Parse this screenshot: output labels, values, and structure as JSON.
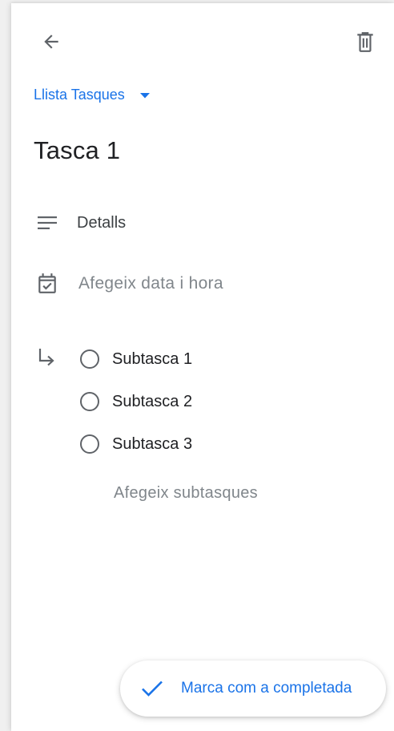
{
  "header": {
    "back_icon": "arrow-left-icon",
    "delete_icon": "trash-icon"
  },
  "list_selector": {
    "label": "Llista Tasques",
    "icon": "caret-down-icon"
  },
  "task": {
    "title": "Tasca 1",
    "details_label": "Detalls",
    "details_icon": "notes-icon",
    "date_placeholder": "Afegeix data i hora",
    "date_icon": "calendar-check-icon"
  },
  "subtasks": {
    "icon": "subdirectory-arrow-icon",
    "items": [
      {
        "label": "Subtasca 1"
      },
      {
        "label": "Subtasca 2"
      },
      {
        "label": "Subtasca 3"
      }
    ],
    "add_label": "Afegeix subtasques"
  },
  "footer": {
    "complete_label": "Marca com a completada",
    "complete_icon": "check-icon"
  },
  "colors": {
    "accent": "#1a73e8",
    "text_primary": "#202124",
    "text_secondary": "#80868b",
    "icon": "#5f6368"
  }
}
